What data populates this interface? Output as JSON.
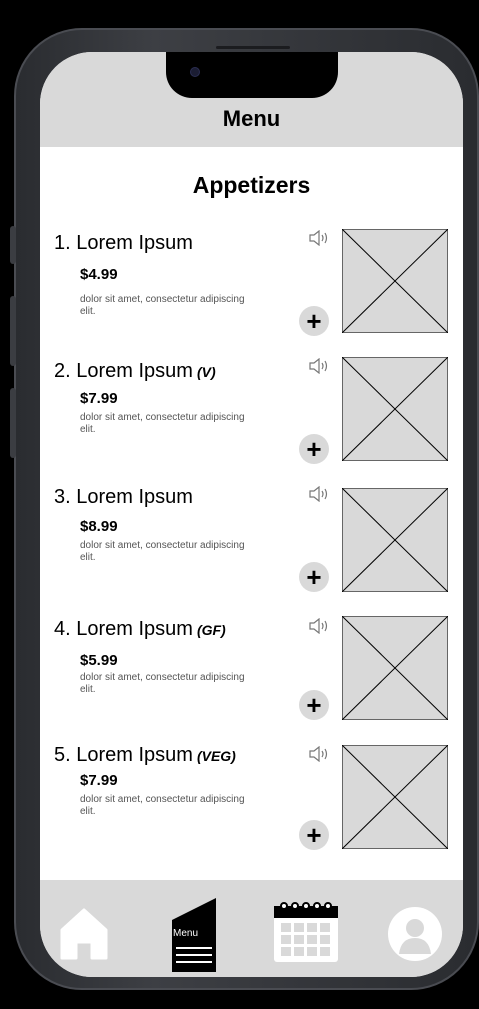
{
  "header": {
    "title": "Menu"
  },
  "section": {
    "title": "Appetizers"
  },
  "items": [
    {
      "name": "1. Lorem Ipsum",
      "tag": "",
      "price": "$4.99",
      "description": "dolor sit amet, consectetur adipiscing elit."
    },
    {
      "name": "2. Lorem Ipsum",
      "tag": "(V)",
      "price": "$7.99",
      "description": "dolor sit amet, consectetur adipiscing elit."
    },
    {
      "name": "3. Lorem Ipsum",
      "tag": "",
      "price": "$8.99",
      "description": "dolor sit amet, consectetur adipiscing elit."
    },
    {
      "name": "4. Lorem Ipsum",
      "tag": "(GF)",
      "price": "$5.99",
      "description": "dolor sit amet, consectetur adipiscing elit."
    },
    {
      "name": "5. Lorem Ipsum",
      "tag": "(VEG)",
      "price": "$7.99",
      "description": "dolor sit amet, consectetur adipiscing elit."
    }
  ],
  "add_label": "+",
  "bottom_nav": {
    "menu_label": "Menu",
    "icons": [
      "home-icon",
      "menu-document-icon",
      "calendar-icon",
      "profile-icon"
    ]
  },
  "colors": {
    "header_bg": "#d9d9d9",
    "placeholder_bg": "#d9d9d9",
    "nav_icon": "#ffffff",
    "frame": "#2f3135"
  }
}
